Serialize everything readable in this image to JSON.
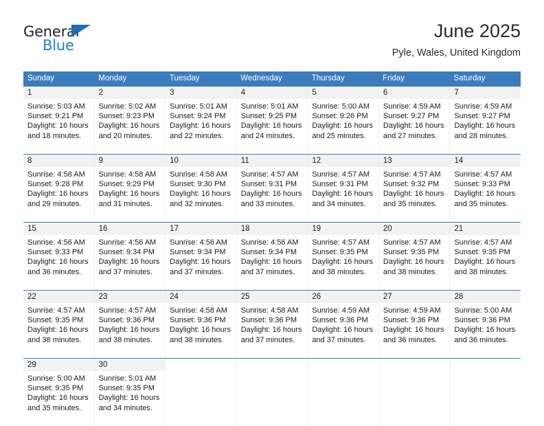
{
  "brand": {
    "name_part1": "General",
    "name_part2": "Blue",
    "triangle_color": "#1f6db4",
    "blue_color": "#1f7fd0"
  },
  "header": {
    "title": "June 2025",
    "location": "Pyle, Wales, United Kingdom"
  },
  "theme": {
    "header_band": "#3a7cbe",
    "daynum_bg": "#f2f2f2",
    "cell_border": "#eeeeee",
    "text": "#1a1a1a"
  },
  "weekdays": [
    "Sunday",
    "Monday",
    "Tuesday",
    "Wednesday",
    "Thursday",
    "Friday",
    "Saturday"
  ],
  "weeks": [
    [
      {
        "day": "1",
        "sunrise": "Sunrise: 5:03 AM",
        "sunset": "Sunset: 9:21 PM",
        "daylight1": "Daylight: 16 hours",
        "daylight2": "and 18 minutes."
      },
      {
        "day": "2",
        "sunrise": "Sunrise: 5:02 AM",
        "sunset": "Sunset: 9:23 PM",
        "daylight1": "Daylight: 16 hours",
        "daylight2": "and 20 minutes."
      },
      {
        "day": "3",
        "sunrise": "Sunrise: 5:01 AM",
        "sunset": "Sunset: 9:24 PM",
        "daylight1": "Daylight: 16 hours",
        "daylight2": "and 22 minutes."
      },
      {
        "day": "4",
        "sunrise": "Sunrise: 5:01 AM",
        "sunset": "Sunset: 9:25 PM",
        "daylight1": "Daylight: 16 hours",
        "daylight2": "and 24 minutes."
      },
      {
        "day": "5",
        "sunrise": "Sunrise: 5:00 AM",
        "sunset": "Sunset: 9:26 PM",
        "daylight1": "Daylight: 16 hours",
        "daylight2": "and 25 minutes."
      },
      {
        "day": "6",
        "sunrise": "Sunrise: 4:59 AM",
        "sunset": "Sunset: 9:27 PM",
        "daylight1": "Daylight: 16 hours",
        "daylight2": "and 27 minutes."
      },
      {
        "day": "7",
        "sunrise": "Sunrise: 4:59 AM",
        "sunset": "Sunset: 9:27 PM",
        "daylight1": "Daylight: 16 hours",
        "daylight2": "and 28 minutes."
      }
    ],
    [
      {
        "day": "8",
        "sunrise": "Sunrise: 4:58 AM",
        "sunset": "Sunset: 9:28 PM",
        "daylight1": "Daylight: 16 hours",
        "daylight2": "and 29 minutes."
      },
      {
        "day": "9",
        "sunrise": "Sunrise: 4:58 AM",
        "sunset": "Sunset: 9:29 PM",
        "daylight1": "Daylight: 16 hours",
        "daylight2": "and 31 minutes."
      },
      {
        "day": "10",
        "sunrise": "Sunrise: 4:58 AM",
        "sunset": "Sunset: 9:30 PM",
        "daylight1": "Daylight: 16 hours",
        "daylight2": "and 32 minutes."
      },
      {
        "day": "11",
        "sunrise": "Sunrise: 4:57 AM",
        "sunset": "Sunset: 9:31 PM",
        "daylight1": "Daylight: 16 hours",
        "daylight2": "and 33 minutes."
      },
      {
        "day": "12",
        "sunrise": "Sunrise: 4:57 AM",
        "sunset": "Sunset: 9:31 PM",
        "daylight1": "Daylight: 16 hours",
        "daylight2": "and 34 minutes."
      },
      {
        "day": "13",
        "sunrise": "Sunrise: 4:57 AM",
        "sunset": "Sunset: 9:32 PM",
        "daylight1": "Daylight: 16 hours",
        "daylight2": "and 35 minutes."
      },
      {
        "day": "14",
        "sunrise": "Sunrise: 4:57 AM",
        "sunset": "Sunset: 9:33 PM",
        "daylight1": "Daylight: 16 hours",
        "daylight2": "and 35 minutes."
      }
    ],
    [
      {
        "day": "15",
        "sunrise": "Sunrise: 4:56 AM",
        "sunset": "Sunset: 9:33 PM",
        "daylight1": "Daylight: 16 hours",
        "daylight2": "and 36 minutes."
      },
      {
        "day": "16",
        "sunrise": "Sunrise: 4:56 AM",
        "sunset": "Sunset: 9:34 PM",
        "daylight1": "Daylight: 16 hours",
        "daylight2": "and 37 minutes."
      },
      {
        "day": "17",
        "sunrise": "Sunrise: 4:56 AM",
        "sunset": "Sunset: 9:34 PM",
        "daylight1": "Daylight: 16 hours",
        "daylight2": "and 37 minutes."
      },
      {
        "day": "18",
        "sunrise": "Sunrise: 4:56 AM",
        "sunset": "Sunset: 9:34 PM",
        "daylight1": "Daylight: 16 hours",
        "daylight2": "and 37 minutes."
      },
      {
        "day": "19",
        "sunrise": "Sunrise: 4:57 AM",
        "sunset": "Sunset: 9:35 PM",
        "daylight1": "Daylight: 16 hours",
        "daylight2": "and 38 minutes."
      },
      {
        "day": "20",
        "sunrise": "Sunrise: 4:57 AM",
        "sunset": "Sunset: 9:35 PM",
        "daylight1": "Daylight: 16 hours",
        "daylight2": "and 38 minutes."
      },
      {
        "day": "21",
        "sunrise": "Sunrise: 4:57 AM",
        "sunset": "Sunset: 9:35 PM",
        "daylight1": "Daylight: 16 hours",
        "daylight2": "and 38 minutes."
      }
    ],
    [
      {
        "day": "22",
        "sunrise": "Sunrise: 4:57 AM",
        "sunset": "Sunset: 9:35 PM",
        "daylight1": "Daylight: 16 hours",
        "daylight2": "and 38 minutes."
      },
      {
        "day": "23",
        "sunrise": "Sunrise: 4:57 AM",
        "sunset": "Sunset: 9:36 PM",
        "daylight1": "Daylight: 16 hours",
        "daylight2": "and 38 minutes."
      },
      {
        "day": "24",
        "sunrise": "Sunrise: 4:58 AM",
        "sunset": "Sunset: 9:36 PM",
        "daylight1": "Daylight: 16 hours",
        "daylight2": "and 38 minutes."
      },
      {
        "day": "25",
        "sunrise": "Sunrise: 4:58 AM",
        "sunset": "Sunset: 9:36 PM",
        "daylight1": "Daylight: 16 hours",
        "daylight2": "and 37 minutes."
      },
      {
        "day": "26",
        "sunrise": "Sunrise: 4:59 AM",
        "sunset": "Sunset: 9:36 PM",
        "daylight1": "Daylight: 16 hours",
        "daylight2": "and 37 minutes."
      },
      {
        "day": "27",
        "sunrise": "Sunrise: 4:59 AM",
        "sunset": "Sunset: 9:36 PM",
        "daylight1": "Daylight: 16 hours",
        "daylight2": "and 36 minutes."
      },
      {
        "day": "28",
        "sunrise": "Sunrise: 5:00 AM",
        "sunset": "Sunset: 9:36 PM",
        "daylight1": "Daylight: 16 hours",
        "daylight2": "and 36 minutes."
      }
    ],
    [
      {
        "day": "29",
        "sunrise": "Sunrise: 5:00 AM",
        "sunset": "Sunset: 9:35 PM",
        "daylight1": "Daylight: 16 hours",
        "daylight2": "and 35 minutes."
      },
      {
        "day": "30",
        "sunrise": "Sunrise: 5:01 AM",
        "sunset": "Sunset: 9:35 PM",
        "daylight1": "Daylight: 16 hours",
        "daylight2": "and 34 minutes."
      },
      {
        "day": "",
        "sunrise": "",
        "sunset": "",
        "daylight1": "",
        "daylight2": ""
      },
      {
        "day": "",
        "sunrise": "",
        "sunset": "",
        "daylight1": "",
        "daylight2": ""
      },
      {
        "day": "",
        "sunrise": "",
        "sunset": "",
        "daylight1": "",
        "daylight2": ""
      },
      {
        "day": "",
        "sunrise": "",
        "sunset": "",
        "daylight1": "",
        "daylight2": ""
      },
      {
        "day": "",
        "sunrise": "",
        "sunset": "",
        "daylight1": "",
        "daylight2": ""
      }
    ]
  ]
}
